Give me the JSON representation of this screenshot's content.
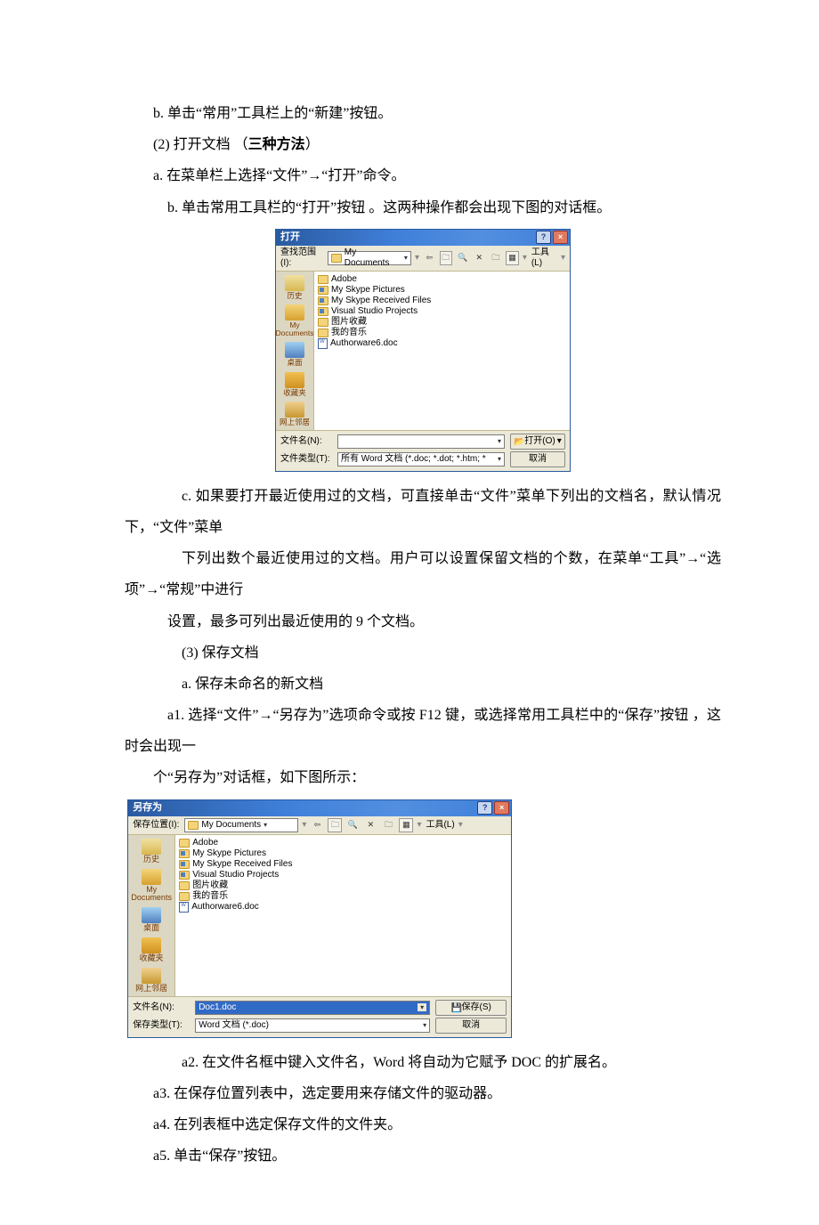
{
  "text": {
    "p1": "b. 单击“常用”工具栏上的“新建”按钮。",
    "p2a": "(2) 打开文档 （",
    "p2b": "三种方法",
    "p2c": "）",
    "p3": "a. 在菜单栏上选择“文件”→“打开”命令。",
    "p4": "b. 单击常用工具栏的“打开”按钮 。这两种操作都会出现下图的对话框。",
    "p5": "c. 如果要打开最近使用过的文档，可直接单击“文件”菜单下列出的文档名，默认情况下，“文件”菜单",
    "p6": "下列出数个最近使用过的文档。用户可以设置保留文档的个数，在菜单“工具”→“选项”→“常规”中进行",
    "p7": "设置，最多可列出最近使用的 9 个文档。",
    "p8": "(3) 保存文档",
    "p9": "a. 保存未命名的新文档",
    "p10": "a1. 选择“文件”→“另存为”选项命令或按 F12 键，或选择常用工具栏中的“保存”按钮 ，这时会出现一",
    "p11": "个“另存为”对话框，如下图所示：",
    "p12": "a2. 在文件名框中键入文件名，Word 将自动为它赋予 DOC 的扩展名。",
    "p13": "a3. 在保存位置列表中，选定要用来存储文件的驱动器。",
    "p14": "a4. 在列表框中选定保存文件的文件夹。",
    "p15": "a5. 单击“保存”按钮。"
  },
  "openDialog": {
    "title": "打开",
    "lookIn_label": "查找范围(I):",
    "lookIn_value": "My Documents",
    "tools_label": "工具(L)",
    "places": {
      "history": "历史",
      "docs": "My Documents",
      "desktop": "桌面",
      "fav": "收藏夹",
      "net": "网上邻居"
    },
    "files": [
      "Adobe",
      "My Skype Pictures",
      "My Skype Received Files",
      "Visual Studio Projects",
      "图片收藏",
      "我的音乐",
      "Authorware6.doc"
    ],
    "fn_label": "文件名(N):",
    "ft_label": "文件类型(T):",
    "ft_value": "所有 Word 文档 (*.doc; *.dot; *.htm; *",
    "open_btn": "打开(O)",
    "cancel_btn": "取消"
  },
  "saveDialog": {
    "title": "另存为",
    "saveIn_label": "保存位置(I):",
    "saveIn_value": "My Documents",
    "tools_label": "工具(L)",
    "places": {
      "history": "历史",
      "docs": "My Documents",
      "desktop": "桌面",
      "fav": "收藏夹",
      "net": "网上邻居"
    },
    "files": [
      "Adobe",
      "My Skype Pictures",
      "My Skype Received Files",
      "Visual Studio Projects",
      "图片收藏",
      "我的音乐",
      "Authorware6.doc"
    ],
    "fn_label": "文件名(N):",
    "fn_value": "Doc1.doc",
    "ft_label": "保存类型(T):",
    "ft_value": "Word 文档 (*.doc)",
    "save_btn": "保存(S)",
    "cancel_btn": "取消"
  }
}
